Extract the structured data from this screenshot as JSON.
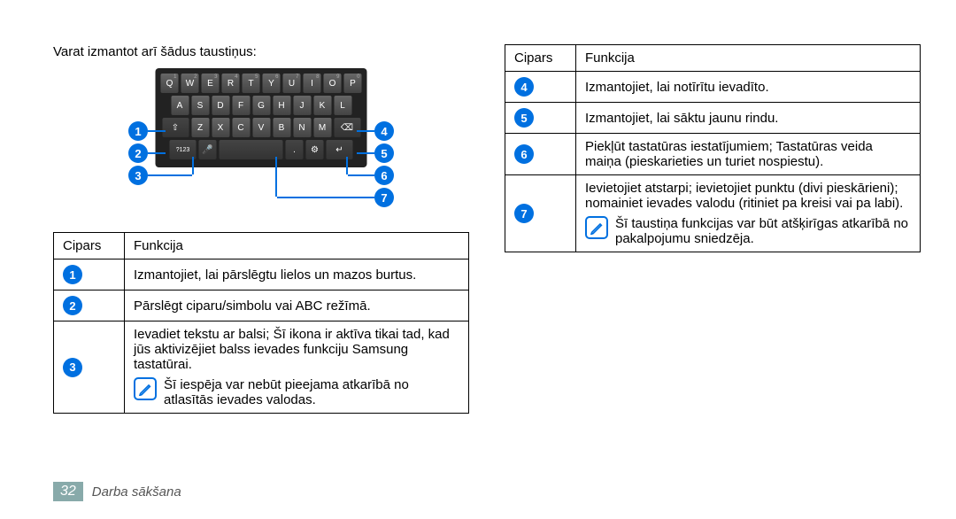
{
  "intro": "Varat izmantot arī šādus taustiņus:",
  "keyboard": {
    "row1": [
      "Q",
      "W",
      "E",
      "R",
      "T",
      "Y",
      "U",
      "I",
      "O",
      "P"
    ],
    "row1_sup": [
      "1",
      "2",
      "3",
      "4",
      "5",
      "6",
      "7",
      "8",
      "9",
      "0"
    ],
    "row2": [
      "A",
      "S",
      "D",
      "F",
      "G",
      "H",
      "J",
      "K",
      "L"
    ],
    "row3_shift": "⇧",
    "row3": [
      "Z",
      "X",
      "C",
      "V",
      "B",
      "N",
      "M"
    ],
    "row3_del": "⌫",
    "row4_mode": "?123",
    "row4_mic": "🎤",
    "row4_dot": ".",
    "row4_gear": "⚙",
    "row4_enter": "↵"
  },
  "callouts_left": [
    "1",
    "2",
    "3"
  ],
  "callouts_right": [
    "4",
    "5",
    "6",
    "7"
  ],
  "table_header": {
    "cipars": "Cipars",
    "funkcija": "Funkcija"
  },
  "left_table": [
    {
      "num": "1",
      "text": "Izmantojiet, lai pārslēgtu lielos un mazos burtus."
    },
    {
      "num": "2",
      "text": "Pārslēgt ciparu/simbolu vai ABC režīmā."
    },
    {
      "num": "3",
      "text": "Ievadiet tekstu ar balsi; Šī ikona ir aktīva tikai tad, kad jūs aktivizējiet balss ievades funkciju Samsung tastatūrai.",
      "note": "Šī iespēja var nebūt pieejama atkarībā no atlasītās ievades valodas."
    }
  ],
  "right_table": [
    {
      "num": "4",
      "text": "Izmantojiet, lai notīrītu ievadīto."
    },
    {
      "num": "5",
      "text": "Izmantojiet, lai sāktu jaunu rindu."
    },
    {
      "num": "6",
      "text": "Piekļūt tastatūras iestatījumiem; Tastatūras veida maiņa (pieskarieties un turiet nospiestu)."
    },
    {
      "num": "7",
      "text": "Ievietojiet atstarpi; ievietojiet punktu (divi pieskārieni); nomainiet ievades valodu (ritiniet pa kreisi vai pa labi).",
      "note": "Šī taustiņa funkcijas var būt atšķirīgas atkarībā no pakalpojumu sniedzēja."
    }
  ],
  "footer": {
    "page": "32",
    "section": "Darba sākšana"
  }
}
